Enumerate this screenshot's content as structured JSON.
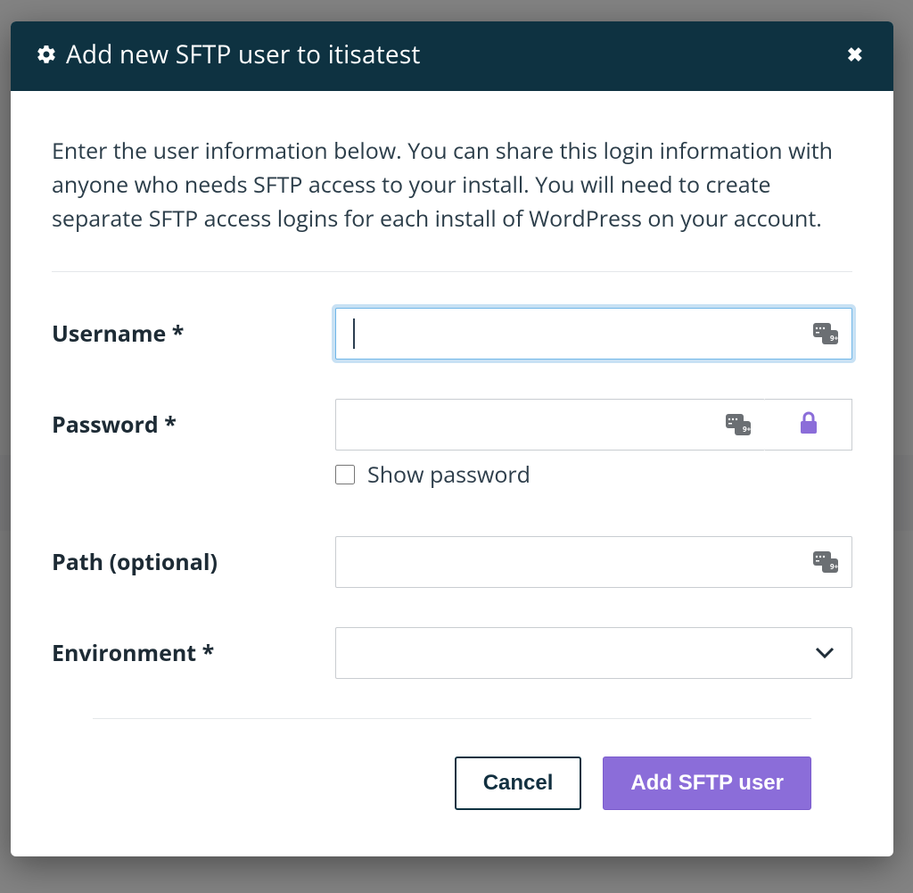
{
  "modal": {
    "title": "Add new SFTP user to itisatest",
    "intro": "Enter the user information below. You can share this login information with anyone who needs SFTP access to your install. You will need to create separate SFTP access logins for each install of WordPress on your account.",
    "fields": {
      "username": {
        "label": "Username *",
        "value": ""
      },
      "password": {
        "label": "Password *",
        "value": ""
      },
      "show_password": {
        "label": "Show password",
        "checked": false
      },
      "path": {
        "label": "Path (optional)",
        "value": ""
      },
      "environment": {
        "label": "Environment *",
        "selected": ""
      }
    },
    "buttons": {
      "cancel": "Cancel",
      "submit": "Add SFTP user"
    },
    "colors": {
      "header_bg": "#0e3241",
      "primary": "#8b6dd9"
    }
  }
}
